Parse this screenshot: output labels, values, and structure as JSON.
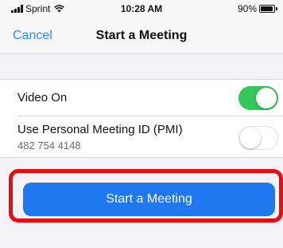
{
  "status_bar": {
    "carrier": "Sprint",
    "time": "10:28 AM",
    "battery": "90%",
    "battery_level": 0.9,
    "wifi_icon": "wifi-icon",
    "signal_icon": "signal-bars-icon"
  },
  "nav": {
    "cancel_label": "Cancel",
    "title": "Start a Meeting"
  },
  "settings": {
    "video_on": {
      "label": "Video On",
      "enabled": true
    },
    "pmi": {
      "label": "Use Personal Meeting ID (PMI)",
      "meeting_id": "482 754 4148",
      "enabled": false
    }
  },
  "actions": {
    "start_label": "Start a Meeting"
  },
  "colors": {
    "accent": "#2d8cff",
    "toggle_on": "#34c759",
    "button": "#1f78f0",
    "highlight": "#e01010"
  }
}
